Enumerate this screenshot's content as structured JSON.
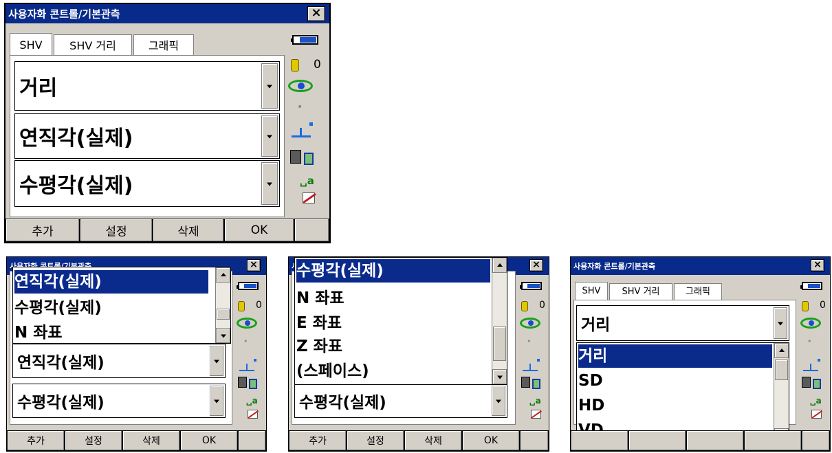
{
  "common": {
    "title": "사용자화 콘트롤/기본관측",
    "close_label": "×",
    "tabs": [
      "SHV",
      "SHV 거리",
      "그래픽"
    ],
    "battery_icon": "battery-icon",
    "prism_value": "0",
    "ppm_dot": "•",
    "text_mode": "␣a",
    "buttons": [
      "추가",
      "설정",
      "삭제",
      "OK"
    ]
  },
  "screen_main": {
    "fields": [
      "거리",
      "연직각(실제)",
      "수평각(실제)"
    ]
  },
  "screen_b": {
    "dropdown_items": [
      "연직각(실제)",
      "수평각(실제)",
      "N 좌표"
    ],
    "fields": [
      "연직각(실제)",
      "수평각(실제)"
    ]
  },
  "screen_c": {
    "dropdown_items": [
      "수평각(실제)",
      "N 좌표",
      "E 좌표",
      "Z 좌표",
      "(스페이스)"
    ],
    "fields": [
      "수평각(실제)"
    ]
  },
  "screen_d": {
    "fields": [
      "거리"
    ],
    "dropdown_items": [
      "거리",
      "SD",
      "HD",
      "VD"
    ]
  },
  "colors": {
    "titlebar": "#082a8a",
    "selection": "#0a2a8c",
    "window_bg": "#d4d0c8"
  }
}
